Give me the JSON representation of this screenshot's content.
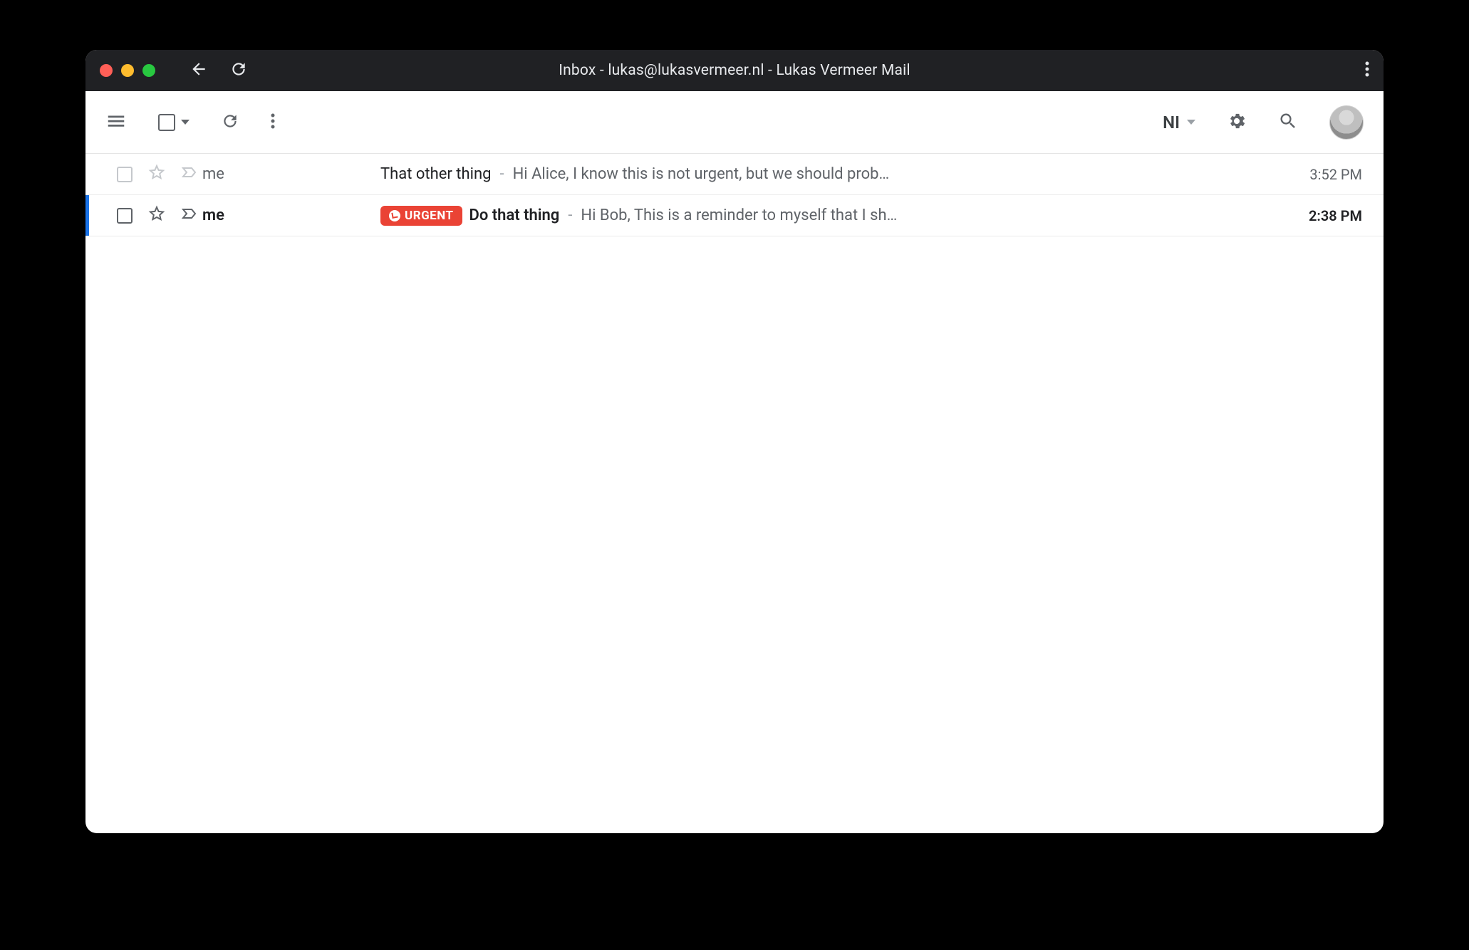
{
  "window": {
    "title": "Inbox - lukas@lukasvermeer.nl - Lukas Vermeer Mail"
  },
  "toolbar": {
    "input_split_label": "NI"
  },
  "messages": [
    {
      "sender": "me",
      "subject": "That other thing",
      "snippet": "Hi Alice, I know this is not urgent, but we should prob…",
      "time": "3:52 PM",
      "read": true,
      "label": null
    },
    {
      "sender": "me",
      "subject": "Do that thing",
      "snippet": "Hi Bob, This is a reminder to myself that I sh…",
      "time": "2:38 PM",
      "read": false,
      "label": "URGENT"
    }
  ]
}
